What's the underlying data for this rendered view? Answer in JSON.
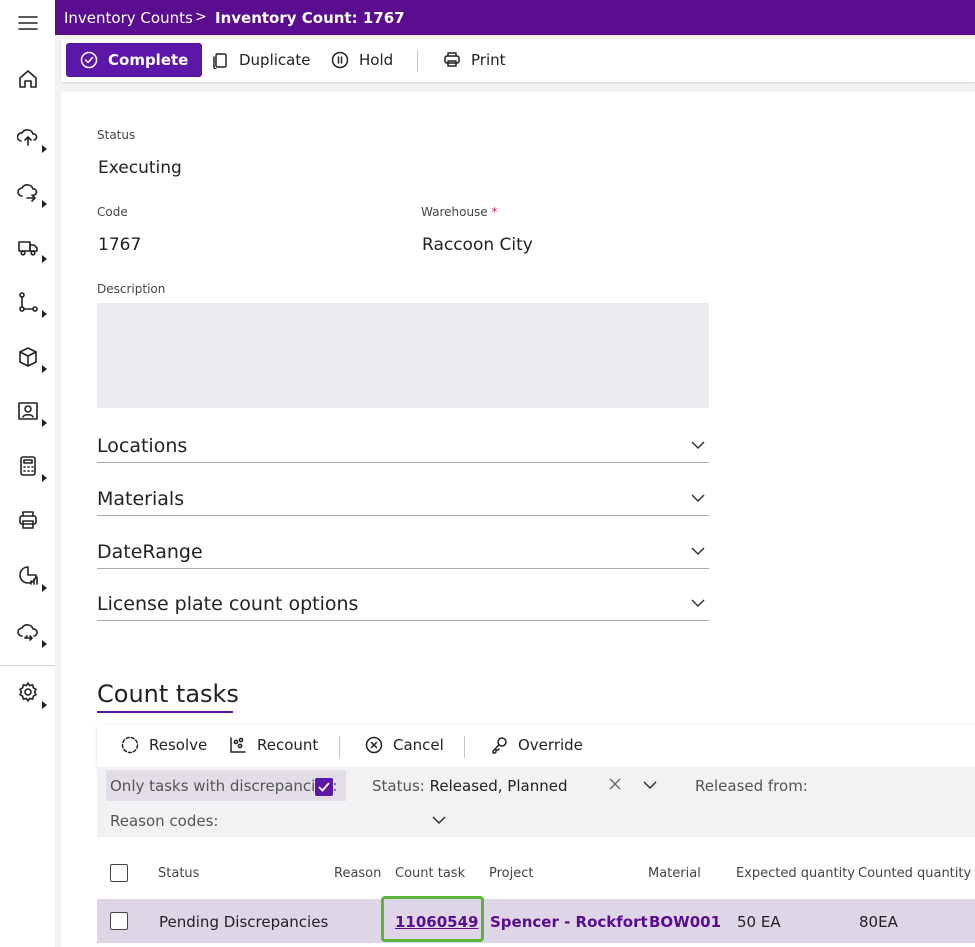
{
  "breadcrumb": {
    "parent": "Inventory Counts",
    "current": "Inventory Count: 1767"
  },
  "nav": [
    {
      "icon": "menu-icon"
    },
    {
      "icon": "home-icon"
    },
    {
      "icon": "inbound-icon"
    },
    {
      "icon": "outbound-icon"
    },
    {
      "icon": "truck-icon"
    },
    {
      "icon": "workflow-icon"
    },
    {
      "icon": "cube-icon"
    },
    {
      "icon": "contact-card-icon"
    },
    {
      "icon": "calculator-icon"
    },
    {
      "icon": "printer-icon"
    },
    {
      "icon": "reports-icon"
    },
    {
      "icon": "cloud-sync-icon"
    },
    {
      "icon": "settings-icon"
    }
  ],
  "toolbar": {
    "complete": "Complete",
    "duplicate": "Duplicate",
    "hold": "Hold",
    "print": "Print"
  },
  "form": {
    "status_label": "Status",
    "status_value": "Executing",
    "code_label": "Code",
    "code_value": "1767",
    "warehouse_label": "Warehouse",
    "warehouse_required": "*",
    "warehouse_value": "Raccoon City",
    "description_label": "Description"
  },
  "accordions": [
    "Locations",
    "Materials",
    "DateRange",
    "License plate count options"
  ],
  "count_tasks": {
    "title": "Count tasks",
    "actions": {
      "resolve": "Resolve",
      "recount": "Recount",
      "cancel": "Cancel",
      "override": "Override"
    },
    "filters": {
      "discrepancies_label": "Only tasks with discrepancies:",
      "discrepancies_checked": true,
      "status_label": "Status:",
      "status_value": "Released, Planned",
      "released_from_label": "Released from:",
      "reason_codes_label": "Reason codes:"
    },
    "columns": [
      "Status",
      "Reason",
      "Count task",
      "Project",
      "Material",
      "Expected quantity",
      "Counted quantity"
    ],
    "rows": [
      {
        "status": "Pending Discrepancies",
        "reason": "",
        "count_task": "11060549",
        "project": "Spencer - Rockfort",
        "material": "BOW001",
        "expected": "50 EA",
        "counted": "80EA"
      }
    ]
  },
  "colors": {
    "brand": "#5a0d8f",
    "primary_button": "#5c16a8",
    "focus_ring": "#5cb53a",
    "row_highlight": "#ded5e6"
  }
}
